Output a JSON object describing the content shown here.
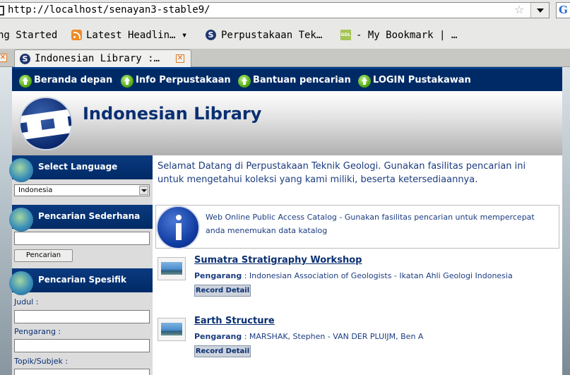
{
  "browser": {
    "url": "http://localhost/senayan3-stable9/",
    "search_engine_letter": "G",
    "bookmarks": [
      {
        "label": "ng Started",
        "icon": "none"
      },
      {
        "label": "Latest Headlin… ▾",
        "icon": "rss-icon"
      },
      {
        "label": "Perpustakaan Tek…",
        "icon": "senayan-icon"
      },
      {
        "label": "- My Bookmark | …",
        "icon": "gdl-icon"
      }
    ],
    "tab_title": "Indonesian Library :…",
    "gdl_icon_text": "GDL"
  },
  "nav": {
    "items": [
      "Beranda depan",
      "Info Perpustakaan",
      "Bantuan pencarian",
      "LOGIN Pustakawan"
    ]
  },
  "header": {
    "title": "Indonesian Library"
  },
  "sidebar": {
    "language": {
      "heading": "Select Language",
      "selected": "Indonesia"
    },
    "simple_search": {
      "heading": "Pencarian Sederhana",
      "button": "Pencarian"
    },
    "advanced_search": {
      "heading": "Pencarian Spesifik",
      "fields": [
        "Judul :",
        "Pengarang :",
        "Topik/Subjek :"
      ]
    }
  },
  "main": {
    "welcome": "Selamat Datang di Perpustakaan Teknik Geologi. Gunakan fasilitas pencarian ini untuk mengetahui koleksi yang kami miliki, beserta ketersediaannya.",
    "opac_text": "Web Online Public Access Catalog - Gunakan fasilitas pencarian untuk mempercepat anda menemukan data katalog",
    "records": [
      {
        "title": "Sumatra Stratigraphy Workshop",
        "author_label": "Pengarang",
        "author": "Indonesian Association of Geologists - Ikatan Ahli Geologi Indonesia",
        "button": "Record Detail"
      },
      {
        "title": "Earth Structure",
        "author_label": "Pengarang",
        "author": "MARSHAK, Stephen - VAN DER PLUIJM, Ben A",
        "button": "Record Detail"
      }
    ]
  },
  "colors": {
    "nav_bg": "#002a66",
    "title_blue": "#0a2f72",
    "text_blue": "#1b3c80",
    "nav_icon_green": "#52a815"
  }
}
